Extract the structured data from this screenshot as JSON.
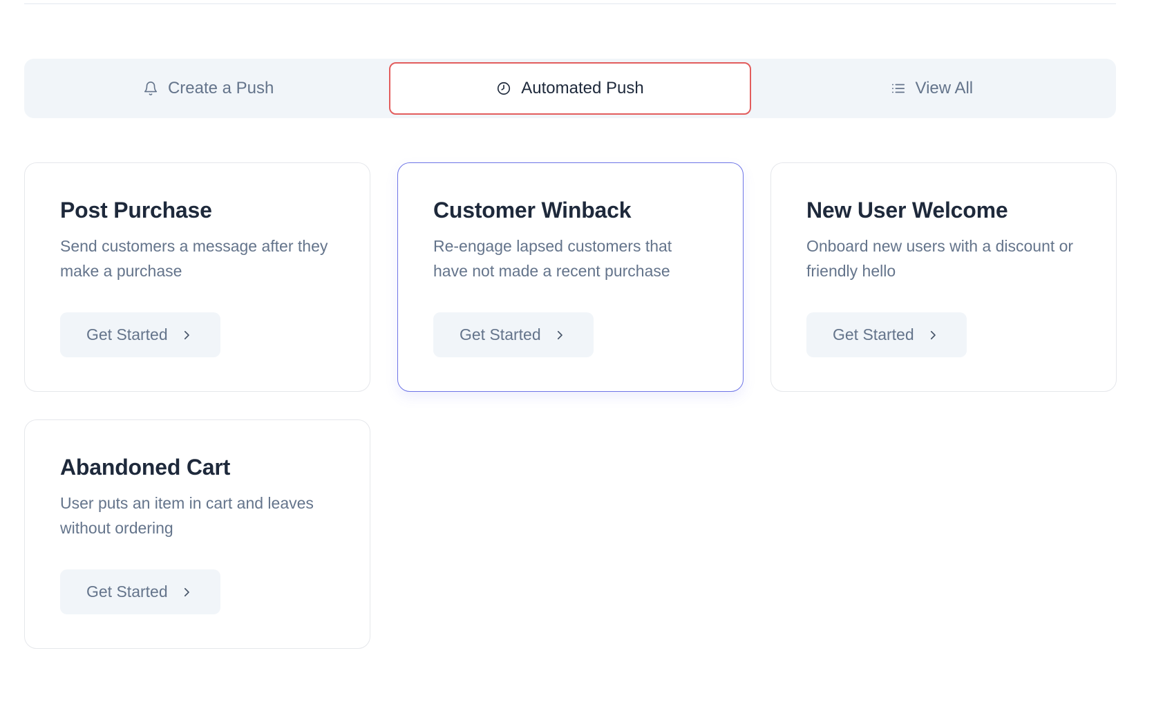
{
  "tabs": [
    {
      "label": "Create a Push",
      "icon": "bell-icon",
      "active": false
    },
    {
      "label": "Automated Push",
      "icon": "clock-icon",
      "active": true
    },
    {
      "label": "View All",
      "icon": "list-icon",
      "active": false
    }
  ],
  "cards": [
    {
      "title": "Post Purchase",
      "description": "Send customers a message after they make a purchase",
      "button_label": "Get Started"
    },
    {
      "title": "Customer Winback",
      "description": "Re-engage lapsed customers that have not made a recent purchase",
      "button_label": "Get Started",
      "highlighted": true
    },
    {
      "title": "New User Welcome",
      "description": "Onboard new users with a discount or friendly hello",
      "button_label": "Get Started"
    },
    {
      "title": "Abandoned Cart",
      "description": "User puts an item in cart and leaves without ordering",
      "button_label": "Get Started"
    }
  ],
  "colors": {
    "active_tab_border": "#e25c5c",
    "highlight_card_border": "#6d74e6",
    "muted_text": "#64748b",
    "heading_text": "#1e293b",
    "tabbar_bg": "#f1f5f9"
  }
}
